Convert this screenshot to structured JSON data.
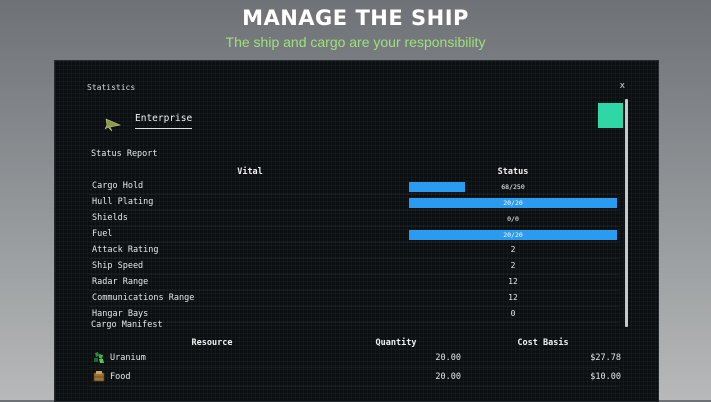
{
  "promo": {
    "title": "MANAGE THE SHIP",
    "subtitle": "The ship and cargo are your responsibility"
  },
  "window": {
    "title": "Statistics",
    "close_label": "x",
    "ship_name": "Enterprise",
    "ship_color": "#2fd7a6"
  },
  "status_report": {
    "title": "Status Report",
    "col_vital": "Vital",
    "col_status": "Status",
    "rows": [
      {
        "label": "Cargo Hold",
        "kind": "bar",
        "text": "68/250",
        "fraction": 0.27
      },
      {
        "label": "Hull Plating",
        "kind": "bar",
        "text": "20/20",
        "fraction": 1.0
      },
      {
        "label": "Shields",
        "kind": "bar",
        "text": "0/0",
        "fraction": 0
      },
      {
        "label": "Fuel",
        "kind": "bar",
        "text": "20/20",
        "fraction": 1.0
      },
      {
        "label": "Attack Rating",
        "kind": "value",
        "text": "2"
      },
      {
        "label": "Ship Speed",
        "kind": "value",
        "text": "2"
      },
      {
        "label": "Radar Range",
        "kind": "value",
        "text": "12"
      },
      {
        "label": "Communications Range",
        "kind": "value",
        "text": "12"
      },
      {
        "label": "Hangar Bays",
        "kind": "value",
        "text": "0"
      }
    ]
  },
  "cargo_manifest": {
    "title": "Cargo Manifest",
    "col_resource": "Resource",
    "col_quantity": "Quantity",
    "col_cost": "Cost Basis",
    "items": [
      {
        "name": "Uranium",
        "icon": "uranium-icon",
        "quantity": "20.00",
        "cost": "$27.78"
      },
      {
        "name": "Food",
        "icon": "food-crate-icon",
        "quantity": "20.00",
        "cost": "$10.00"
      }
    ]
  },
  "colors": {
    "bar_fill": "#2a9bf0",
    "headline_sub": "#9fe07c",
    "window_bg": "#0b0f12"
  }
}
